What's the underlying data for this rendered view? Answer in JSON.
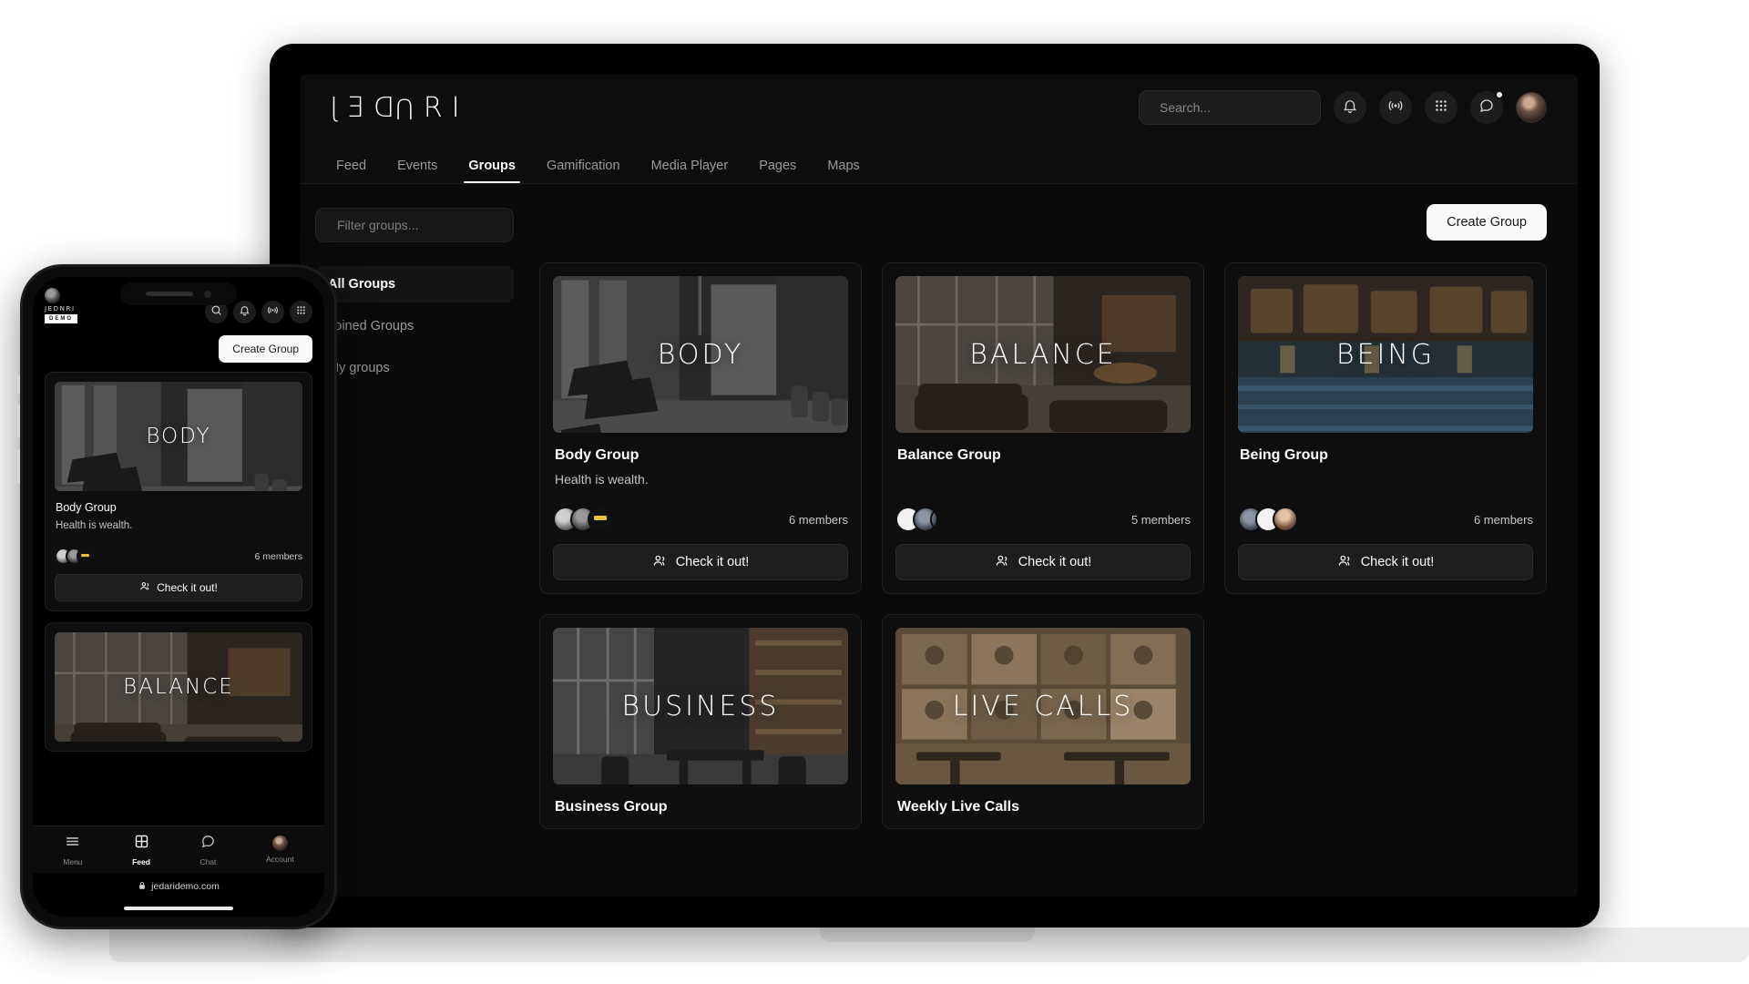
{
  "brand": {
    "name": "JEDNRI",
    "letters": [
      "J",
      "E",
      "D",
      "N",
      "R",
      "I"
    ]
  },
  "header": {
    "search_placeholder": "Search...",
    "search_value": "",
    "icons": [
      {
        "name": "bell-icon",
        "label": "Notifications"
      },
      {
        "name": "broadcast-icon",
        "label": "Live"
      },
      {
        "name": "grid-apps-icon",
        "label": "Apps"
      },
      {
        "name": "chat-bubble-icon",
        "label": "Messages",
        "badge": true
      }
    ],
    "avatar_label": "Account"
  },
  "nav": {
    "tabs": [
      {
        "label": "Feed",
        "active": false
      },
      {
        "label": "Events",
        "active": false
      },
      {
        "label": "Groups",
        "active": true
      },
      {
        "label": "Gamification",
        "active": false
      },
      {
        "label": "Media Player",
        "active": false
      },
      {
        "label": "Pages",
        "active": false
      },
      {
        "label": "Maps",
        "active": false
      }
    ]
  },
  "sidebar": {
    "filter_placeholder": "Filter groups...",
    "filter_value": "",
    "items": [
      {
        "label": "All Groups",
        "active": true
      },
      {
        "label": "Joined Groups",
        "active": false
      },
      {
        "label": "My groups",
        "active": false
      }
    ]
  },
  "toolbar": {
    "create_group_label": "Create Group"
  },
  "groups": {
    "check_label": "Check it out!",
    "cards": [
      {
        "overlay": "BODY",
        "title": "Body Group",
        "desc": "Health is wealth.",
        "members": "6 members",
        "scene": "gym"
      },
      {
        "overlay": "BALANCE",
        "title": "Balance Group",
        "desc": "",
        "members": "5 members",
        "scene": "lounge"
      },
      {
        "overlay": "BEING",
        "title": "Being Group",
        "desc": "",
        "members": "6 members",
        "scene": "spa"
      },
      {
        "overlay": "BUSINESS",
        "title": "Business Group",
        "desc": "",
        "members": "",
        "scene": "office"
      },
      {
        "overlay": "LIVE CALLS",
        "title": "Weekly Live Calls",
        "desc": "",
        "members": "",
        "scene": "calls"
      }
    ]
  },
  "phone": {
    "brand": "JEDNRI",
    "demo_badge": "DEMO",
    "create_group_label": "Create Group",
    "check_label": "Check it out!",
    "icons": [
      {
        "name": "search-icon"
      },
      {
        "name": "bell-icon"
      },
      {
        "name": "broadcast-icon"
      },
      {
        "name": "grid-apps-icon"
      }
    ],
    "cards": [
      {
        "overlay": "BODY",
        "title": "Body Group",
        "desc": "Health is wealth.",
        "members": "6 members",
        "scene": "gym"
      },
      {
        "overlay": "BALANCE",
        "title": "",
        "desc": "",
        "members": "",
        "scene": "lounge"
      }
    ],
    "bottom_nav": [
      {
        "label": "Menu",
        "icon": "hamburger-icon",
        "active": false
      },
      {
        "label": "Feed",
        "icon": "grid-icon",
        "active": true
      },
      {
        "label": "Chat",
        "icon": "chat-bubble-icon",
        "active": false
      },
      {
        "label": "Account",
        "icon": "avatar-icon",
        "active": false
      }
    ],
    "url": "jedaridemo.com"
  },
  "colors": {
    "page_bg": "#ffffff",
    "app_bg": "#0a0a0a",
    "header_bg": "#0d0d0d",
    "card_bg": "#0e0e0e",
    "accent_white": "#fafafa",
    "text_primary": "#ffffff",
    "text_muted": "#9a9a9a"
  }
}
